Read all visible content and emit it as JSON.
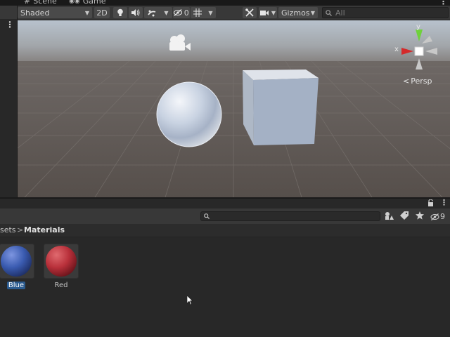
{
  "tabs": [
    {
      "label": "Scene",
      "icon": "hash-icon"
    },
    {
      "label": "Game",
      "icon": "gamepad-icon"
    }
  ],
  "scene_toolbar": {
    "shading_mode": "Shaded",
    "mode_2d": "2D",
    "hidden_count": "0",
    "gizmos_label": "Gizmos",
    "search_placeholder": "All"
  },
  "gizmo": {
    "y_label": "y",
    "x_label": "x",
    "projection_label": "Persp"
  },
  "project": {
    "breadcrumb_parent": "sets",
    "breadcrumb_separator": ">",
    "breadcrumb_current": "Materials",
    "search_placeholder": "",
    "hidden_count": "9",
    "assets": [
      {
        "name": "Blue",
        "color": "#3a5bb0",
        "selected": true
      },
      {
        "name": "Red",
        "color": "#b8303a",
        "selected": false
      }
    ]
  },
  "colors": {
    "accent_selection": "#2b5b8f",
    "gizmo_y": "#6fd13b",
    "gizmo_x": "#d42a2a",
    "sky_top": "#a9b4c2",
    "ground": "#5e5753"
  }
}
